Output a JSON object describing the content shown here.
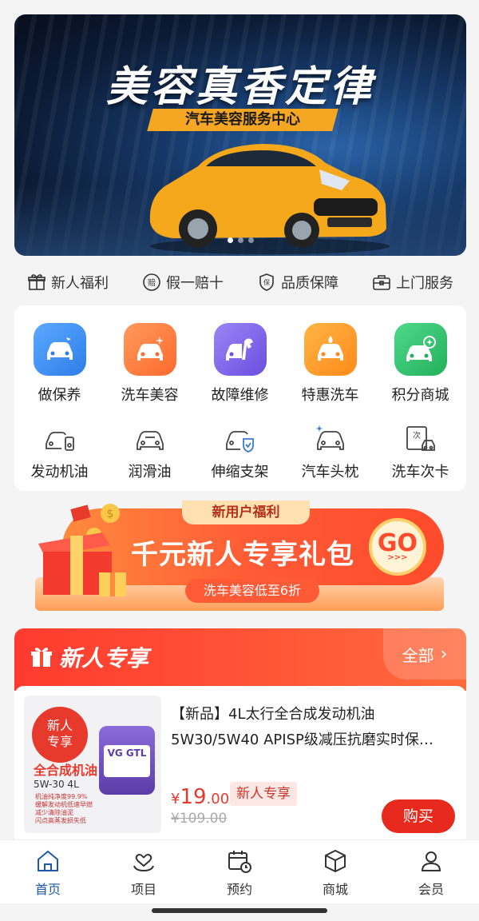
{
  "banner": {
    "title": "美容真香定律",
    "subtitle": "汽车美容服务中心"
  },
  "guarantees": [
    {
      "icon": "gift-icon",
      "label": "新人福利"
    },
    {
      "icon": "compensation-icon",
      "label": "假一赔十"
    },
    {
      "icon": "shield-icon",
      "label": "品质保障"
    },
    {
      "icon": "toolbox-icon",
      "label": "上门服务"
    }
  ],
  "services_top": [
    {
      "icon": "car-care-icon",
      "label": "做保养",
      "color": "#3a8ff0"
    },
    {
      "icon": "car-wash-icon",
      "label": "洗车美容",
      "color": "#ff7a3d"
    },
    {
      "icon": "repair-icon",
      "label": "故障维修",
      "color": "#7b62e8"
    },
    {
      "icon": "discount-wash-icon",
      "label": "特惠洗车",
      "color": "#ff9a2e"
    },
    {
      "icon": "points-mall-icon",
      "label": "积分商城",
      "color": "#2fc26a"
    }
  ],
  "services_bottom": [
    {
      "icon": "engine-oil-icon",
      "label": "发动机油"
    },
    {
      "icon": "lubricant-icon",
      "label": "润滑油"
    },
    {
      "icon": "bracket-icon",
      "label": "伸缩支架"
    },
    {
      "icon": "headrest-icon",
      "label": "汽车头枕"
    },
    {
      "icon": "wash-card-icon",
      "label": "洗车次卡"
    }
  ],
  "promo": {
    "tag": "新用户福利",
    "headline": "千元新人专享礼包",
    "go": "GO",
    "go_arrows": ">>>",
    "sub": "洗车美容低至6折"
  },
  "new_user": {
    "title": "新人专享",
    "all": "全部",
    "product": {
      "thumb_badge": "新人\n专享",
      "thumb_name": "全合成机油",
      "thumb_spec": "5W-30 4L",
      "thumb_lines": [
        "机油纯净度99.9%",
        "缓解发动机低速早燃",
        "减少清除油泥",
        "闪点高蒸发损失低"
      ],
      "jug_label": "VG GTL",
      "title": "【新品】4L太行全合成发动机油 5W30/5W40 APISP级减压抗磨实时保…",
      "price_currency": "¥",
      "price_int": "19",
      "price_dec": ".00",
      "badge": "新人专享",
      "original_price": "¥109.00",
      "buy": "购买"
    }
  },
  "tabs": [
    {
      "icon": "home-icon",
      "label": "首页",
      "active": true
    },
    {
      "icon": "project-icon",
      "label": "项目",
      "active": false
    },
    {
      "icon": "calendar-icon",
      "label": "预约",
      "active": false
    },
    {
      "icon": "mall-icon",
      "label": "商城",
      "active": false
    },
    {
      "icon": "member-icon",
      "label": "会员",
      "active": false
    }
  ],
  "colors": {
    "accent_red": "#e8291d",
    "tab_active": "#1e5aa8",
    "promo_orange": "#ff5a36"
  }
}
